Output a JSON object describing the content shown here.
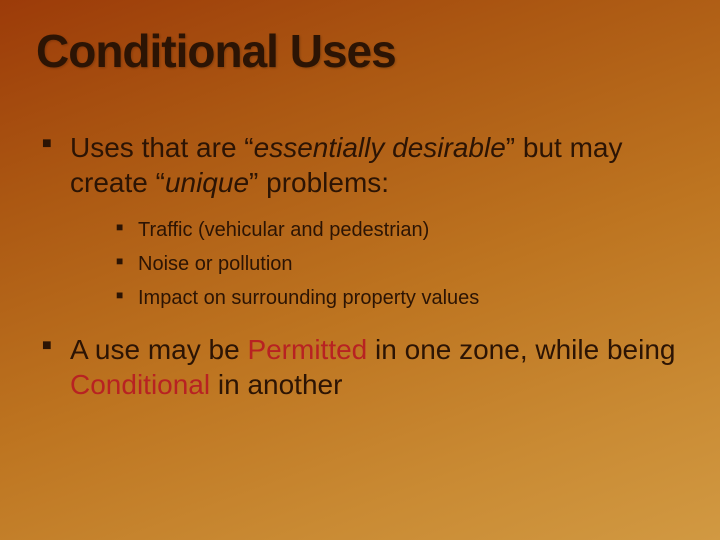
{
  "title": "Conditional Uses",
  "b1": {
    "pre": "Uses that are “",
    "em1": "essentially desirable",
    "mid": "” but may create “",
    "em2": "unique",
    "post": "” problems:"
  },
  "sub": [
    "Traffic (vehicular and pedestrian)",
    "Noise or pollution",
    "Impact on surrounding property values"
  ],
  "b2": {
    "pre": "A use may be ",
    "w1": "Permitted",
    "mid": " in one zone, while being ",
    "w2": "Conditional",
    "post": " in another"
  }
}
